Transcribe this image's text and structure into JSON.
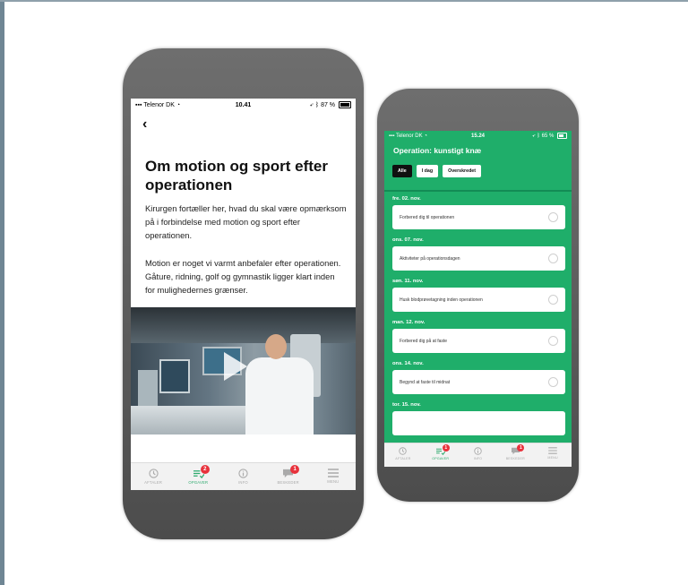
{
  "phone_left": {
    "status": {
      "carrier": "Telenor DK",
      "time": "10.41",
      "battery": "87 %"
    },
    "back_label": "‹",
    "title": "Om motion og sport efter operationen",
    "paragraphs": [
      "Kirurgen fortæller her, hvad du skal være opmærksom på i forbindelse med motion og sport efter operationen.",
      "Motion er noget vi varmt anbefaler efter operationen. Gåture, ridning, golf og gymnastik ligger klart inden for mulighedernes grænser."
    ],
    "tabs": [
      {
        "label": "Aftaler",
        "icon": "clock-icon"
      },
      {
        "label": "Opgaver",
        "icon": "tasks-icon",
        "badge": "2",
        "active": true
      },
      {
        "label": "Info",
        "icon": "info-icon"
      },
      {
        "label": "Beskeder",
        "icon": "chat-icon",
        "badge": "1"
      },
      {
        "label": "Menu",
        "icon": "menu-icon"
      }
    ]
  },
  "phone_right": {
    "status": {
      "carrier": "Telenor DK",
      "time": "15.24",
      "battery": "65 %"
    },
    "title": "Operation: kunstigt knæ",
    "filters": [
      "Alle",
      "I dag",
      "Overskredet"
    ],
    "days": [
      {
        "label": "fre. 02. nov.",
        "task": "Forbered dig til operationen"
      },
      {
        "label": "ons. 07. nov.",
        "task": "Aktiviteter på operationsdagen"
      },
      {
        "label": "søn. 11. nov.",
        "task": "Husk blodprøvetagning inden operationen"
      },
      {
        "label": "man. 12. nov.",
        "task": "Forbered dig på at faste"
      },
      {
        "label": "ons. 14. nov.",
        "task": "Begynd at faste til midnat"
      },
      {
        "label": "tor. 15. nov.",
        "task": ""
      }
    ],
    "tabs": [
      {
        "label": "Aftaler"
      },
      {
        "label": "Opgaver",
        "badge": "1",
        "active": true
      },
      {
        "label": "Info"
      },
      {
        "label": "Beskeder",
        "badge": "1"
      },
      {
        "label": "Menu"
      }
    ]
  },
  "colors": {
    "accent": "#1fae6a",
    "badge": "#e8323c"
  }
}
